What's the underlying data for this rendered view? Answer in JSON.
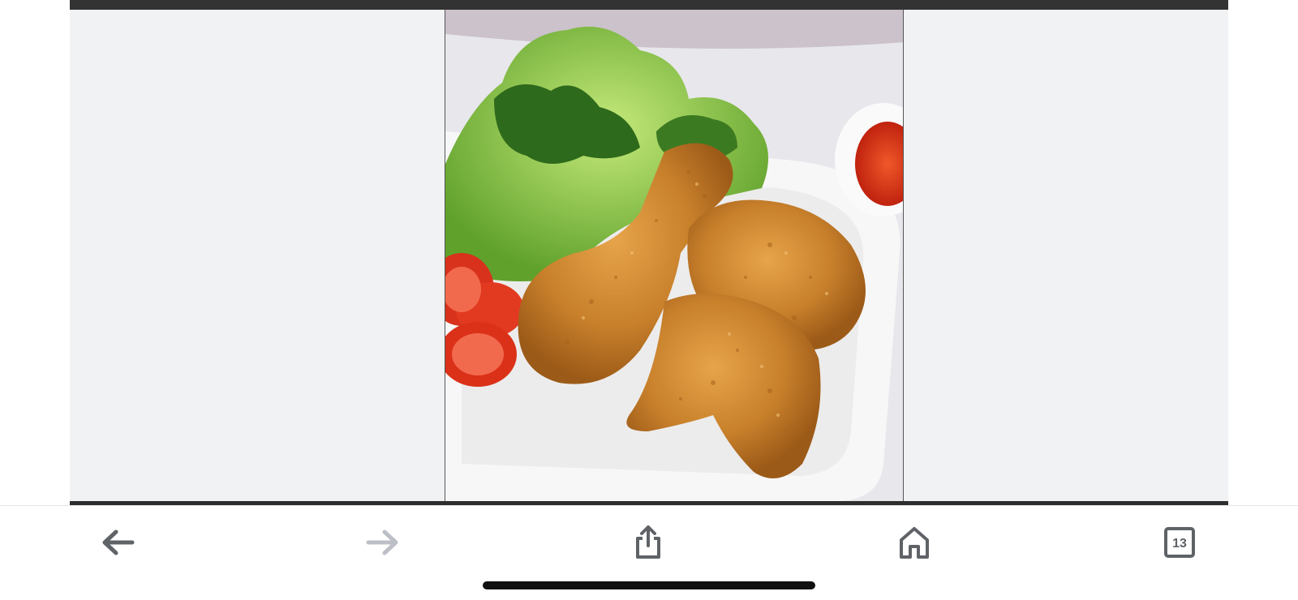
{
  "photo": {
    "subject": "fried-chicken-plate"
  },
  "toolbar": {
    "back_icon": "arrow-left-icon",
    "forward_icon": "arrow-right-icon",
    "share_icon": "share-icon",
    "home_icon": "home-icon",
    "tabs_icon": "tabs-icon",
    "tabs_count": "13"
  },
  "colors": {
    "icon_active": "#5f6368",
    "icon_disabled": "#bcc0c6",
    "frame_background": "#f0f2f4",
    "frame_border": "#333333"
  }
}
